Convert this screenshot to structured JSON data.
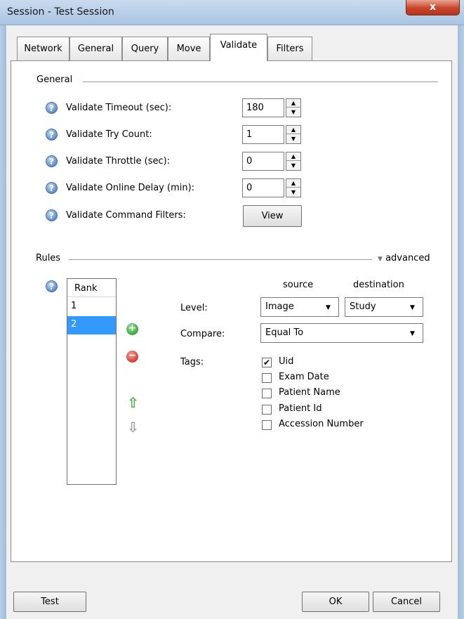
{
  "window": {
    "title": "Session - Test Session",
    "close_glyph": "x"
  },
  "tabs": [
    {
      "label": "Network",
      "active": false
    },
    {
      "label": "General",
      "active": false
    },
    {
      "label": "Query",
      "active": false
    },
    {
      "label": "Move",
      "active": false
    },
    {
      "label": "Validate",
      "active": true
    },
    {
      "label": "Filters",
      "active": false
    }
  ],
  "general": {
    "section_label": "General",
    "fields": [
      {
        "label": "Validate Timeout (sec):",
        "value": "180"
      },
      {
        "label": "Validate Try Count:",
        "value": "1"
      },
      {
        "label": "Validate Throttle (sec):",
        "value": "0"
      },
      {
        "label": "Validate Online Delay (min):",
        "value": "0"
      }
    ],
    "command_filters": {
      "label": "Validate Command Filters:",
      "button_label": "View"
    }
  },
  "rules": {
    "section_label": "Rules",
    "advanced_label": "advanced",
    "rank_header": "Rank",
    "ranks": [
      "1",
      "2"
    ],
    "selected_rank": "2",
    "source_header": "source",
    "destination_header": "destination",
    "level_label": "Level:",
    "level_source": "Image",
    "level_destination": "Study",
    "compare_label": "Compare:",
    "compare_value": "Equal To",
    "tags_label": "Tags:",
    "tags": [
      {
        "label": "Uid",
        "checked": true
      },
      {
        "label": "Exam Date",
        "checked": false
      },
      {
        "label": "Patient Name",
        "checked": false
      },
      {
        "label": "Patient Id",
        "checked": false
      },
      {
        "label": "Accession Number",
        "checked": false
      }
    ]
  },
  "footer": {
    "test_label": "Test",
    "ok_label": "OK",
    "cancel_label": "Cancel"
  },
  "colors": {
    "selection": "#3399ff",
    "add_green": "#3fae3f",
    "remove_red": "#d9423a",
    "help_blue": "#5b8dcc"
  },
  "icons": [
    "help-icon",
    "add-rule-icon",
    "remove-rule-icon",
    "move-up-icon",
    "move-down-icon",
    "dropdown-arrow-icon",
    "advanced-chevron-icon",
    "close-icon"
  ]
}
